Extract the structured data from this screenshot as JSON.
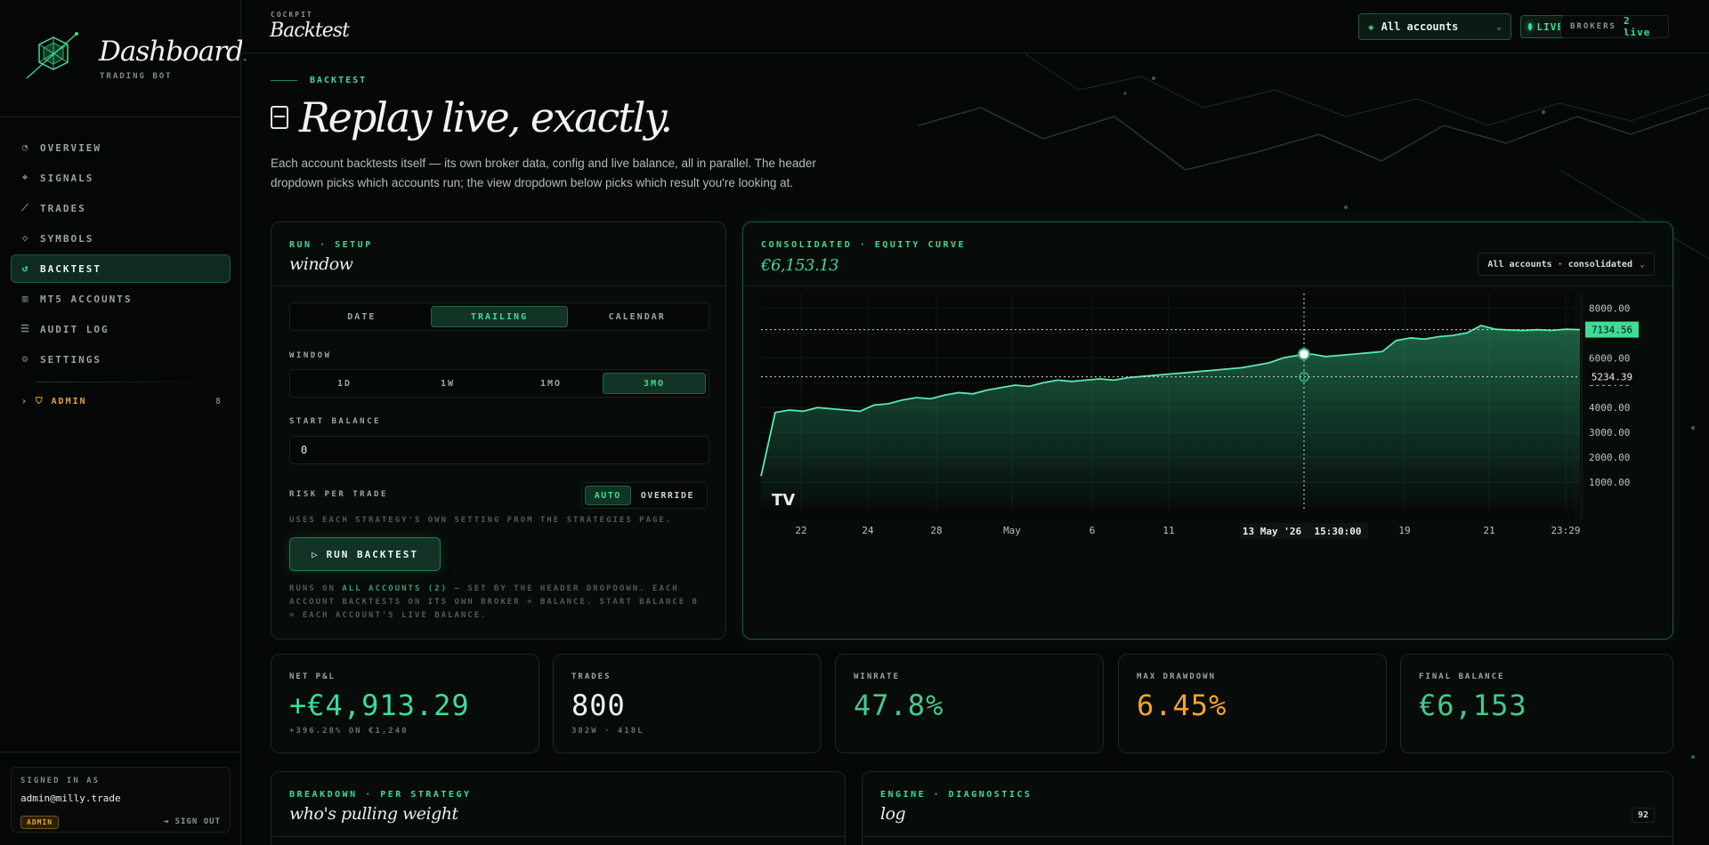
{
  "brand": {
    "title": "Dashboard",
    "dot": ".",
    "subtitle": "TRADING BOT"
  },
  "nav": [
    {
      "label": "OVERVIEW",
      "icon": "gauge-icon"
    },
    {
      "label": "SIGNALS",
      "icon": "crosshair-icon"
    },
    {
      "label": "TRADES",
      "icon": "chart-line-icon"
    },
    {
      "label": "SYMBOLS",
      "icon": "tag-icon"
    },
    {
      "label": "BACKTEST",
      "icon": "history-icon",
      "active": true
    },
    {
      "label": "MT5 ACCOUNTS",
      "icon": "building-icon"
    },
    {
      "label": "AUDIT LOG",
      "icon": "list-icon"
    },
    {
      "label": "SETTINGS",
      "icon": "gear-icon"
    }
  ],
  "admin": {
    "label": "ADMIN",
    "count": "8"
  },
  "user": {
    "signed_label": "SIGNED IN AS",
    "email": "admin@milly.trade",
    "role": "ADMIN",
    "signout": "SIGN OUT"
  },
  "topbar": {
    "crumb": "COCKPIT",
    "title": "Backtest",
    "accounts": "All accounts",
    "live": "LIVE",
    "brokers_label": "BROKERS",
    "brokers_value": "2 live"
  },
  "page": {
    "eyebrow": "BACKTEST",
    "hero": "Replay live, exactly.",
    "description": "Each account backtests itself — its own broker data, config and live balance, all in parallel. The header dropdown picks which accounts run; the view dropdown below picks which result you're looking at."
  },
  "run_setup": {
    "kicker": "RUN · SETUP",
    "title": "window",
    "modes": [
      "DATE",
      "TRAILING",
      "CALENDAR"
    ],
    "mode_selected": "TRAILING",
    "window_label": "WINDOW",
    "windows": [
      "1D",
      "1W",
      "1MO",
      "3MO"
    ],
    "window_selected": "3MO",
    "start_balance_label": "START BALANCE",
    "start_balance": "0",
    "risk_label": "RISK PER TRADE",
    "risk_options": [
      "AUTO",
      "OVERRIDE"
    ],
    "risk_selected": "AUTO",
    "risk_note": "USES EACH STRATEGY'S OWN SETTING FROM THE STRATEGIES PAGE.",
    "run_button": "RUN BACKTEST",
    "footer_note_1": "RUNS ON ",
    "footer_note_hl": "ALL ACCOUNTS (2)",
    "footer_note_2": " — SET BY THE HEADER DROPDOWN. EACH ACCOUNT BACKTESTS ON ITS OWN BROKER + BALANCE. START BALANCE 0 = EACH ACCOUNT'S LIVE BALANCE."
  },
  "equity": {
    "kicker": "CONSOLIDATED · EQUITY CURVE",
    "value": "€6,153.13",
    "view": "All accounts · consolidated",
    "last_label": "7134.56",
    "cursor_label": "5234.39",
    "cursor_date": "13 May '26",
    "cursor_time": "15:30:00",
    "watermark": "TV"
  },
  "chart_data": {
    "type": "area",
    "ylim": [
      500,
      8300
    ],
    "yticks": [
      "8000.00",
      "7000.00",
      "6000.00",
      "5000.00",
      "4000.00",
      "3000.00",
      "2000.00",
      "1000.00"
    ],
    "xticks": [
      "22",
      "24",
      "28",
      "May",
      "6",
      "11",
      "13 May '26",
      "19",
      "21",
      "23:29"
    ],
    "series": [
      {
        "values": [
          1240,
          3800,
          3900,
          3850,
          4000,
          3950,
          3900,
          3850,
          4100,
          4150,
          4300,
          4400,
          4350,
          4500,
          4600,
          4550,
          4700,
          4800,
          4900,
          4850,
          5000,
          5100,
          5050,
          5100,
          5150,
          5100,
          5200,
          5250,
          5300,
          5350,
          5400,
          5450,
          5500,
          5550,
          5600,
          5700,
          5800,
          6000,
          6100,
          6150,
          6050,
          6100,
          6150,
          6200,
          6250,
          6700,
          6800,
          6750,
          6850,
          6900,
          7000,
          7300,
          7150,
          7120,
          7100,
          7130,
          7100,
          7150,
          7134.56
        ]
      }
    ],
    "crosshair": {
      "x_label": "13 May '26 15:30:00",
      "y_value": 5234.39
    }
  },
  "stats": [
    {
      "key": "NET P&L",
      "value": "+€4,913.29",
      "sub": "+396.28% ON €1,240",
      "color": "#3ddc97"
    },
    {
      "key": "TRADES",
      "value": "800",
      "sub": "382W · 418L",
      "color": "#f0f5f2"
    },
    {
      "key": "WINRATE",
      "value": "47.8%",
      "sub": "",
      "color": "#46c98a"
    },
    {
      "key": "MAX DRAWDOWN",
      "value": "6.45%",
      "sub": "",
      "color": "#f0a531"
    },
    {
      "key": "FINAL BALANCE",
      "value": "€6,153",
      "sub": "",
      "color": "#46c98a"
    }
  ],
  "breakdown": {
    "kicker": "BREAKDOWN · PER STRATEGY",
    "title": "who's pulling weight"
  },
  "engine": {
    "kicker": "ENGINE · DIAGNOSTICS",
    "title": "log",
    "count": "92"
  },
  "colors": {
    "accent": "#3ddc97",
    "warning": "#f0a531",
    "background": "#050807"
  }
}
